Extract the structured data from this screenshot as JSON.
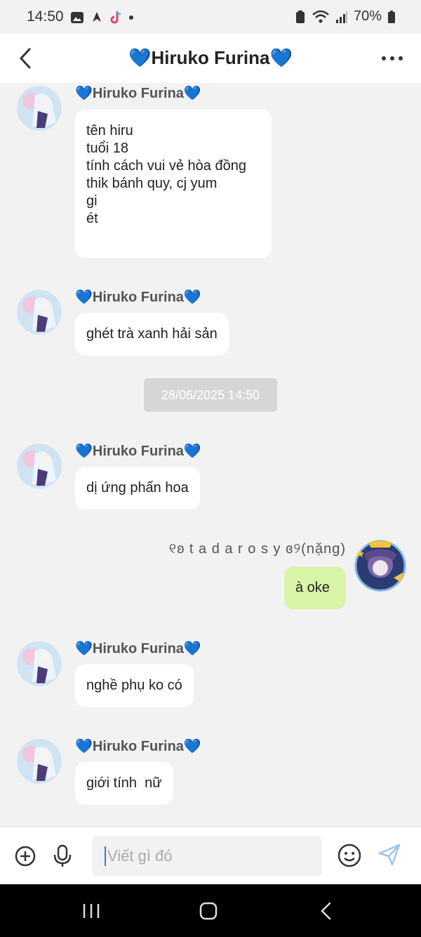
{
  "status": {
    "time": "14:50",
    "battery": "70%"
  },
  "header": {
    "title": "💙Hiruko Furina💙"
  },
  "messages": {
    "m1": {
      "sender": "💙Hiruko Furina💙",
      "text": "tên hiru\ntuổi 18\ntính cách vui vẻ hòa đồng\nthik bánh quy, cj yum\ngi\nét"
    },
    "m2": {
      "sender": "💙Hiruko Furina💙",
      "text": "ghét trà xanh hải sản"
    },
    "timestamp": "28/06/2025 14:50",
    "m3": {
      "sender": "💙Hiruko Furina💙",
      "text": "dị ứng phấn hoa"
    },
    "m4": {
      "sender": "୧ʚ t a d a r o s y ɞ୨(nặng)",
      "text": "à oke"
    },
    "m5": {
      "sender": "💙Hiruko Furina💙",
      "text": "nghề phụ ko có"
    },
    "m6": {
      "sender": "💙Hiruko Furina💙",
      "text": "giới tính  nữ"
    }
  },
  "composer": {
    "placeholder": "Viết gì đó"
  },
  "icons": [
    "back-arrow-icon",
    "more-options-icon",
    "add-icon",
    "microphone-icon",
    "emoji-icon",
    "send-icon",
    "recent-apps-icon",
    "home-icon",
    "nav-back-icon"
  ],
  "colors": {
    "my_bubble": "#d8f4a6",
    "accent": "#2d7be5"
  }
}
